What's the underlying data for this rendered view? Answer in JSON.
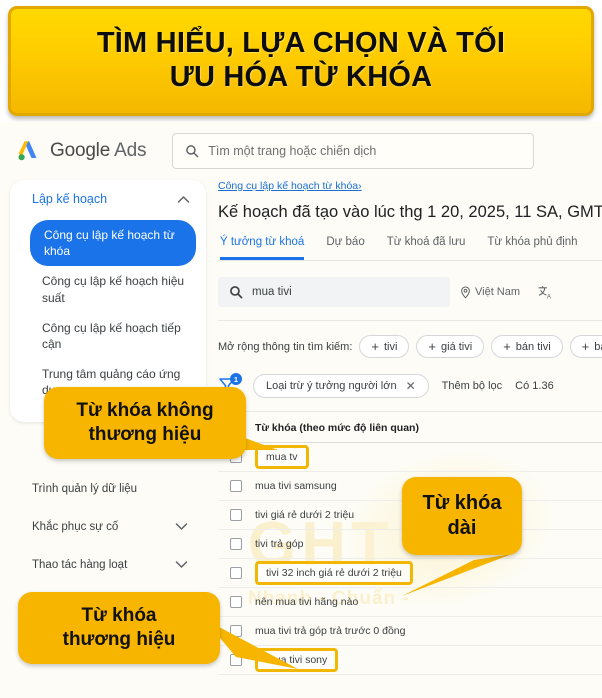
{
  "banner": {
    "line1": "TÌM HIỂU, LỰA CHỌN VÀ TỐI",
    "line2": "ƯU HÓA TỪ KHÓA"
  },
  "watermark": {
    "big": "GHT",
    "small": "Nhanh - Chuẩn -"
  },
  "topbar": {
    "logo_text": "Google",
    "logo_suffix": "Ads",
    "search_placeholder": "Tìm một trang hoặc chiến dịch",
    "search_icon": "search-icon"
  },
  "sidebar": {
    "header": "Lập kế hoạch",
    "header_chevron": "chevron-up-icon",
    "items": [
      {
        "label": "Công cụ lập kế hoạch từ khóa",
        "active": true
      },
      {
        "label": "Công cụ lập kế hoạch hiệu suất",
        "active": false
      },
      {
        "label": "Công cụ lập kế hoạch tiếp cận",
        "active": false
      },
      {
        "label": "Trung tâm quảng cáo ứng dụng",
        "active": false
      }
    ],
    "lower_items": [
      {
        "label": "Trình quản lý dữ liệu",
        "chevron": false
      },
      {
        "label": "Khắc phục sự cố",
        "chevron": true
      },
      {
        "label": "Thao tác hàng loạt",
        "chevron": true
      }
    ]
  },
  "main": {
    "breadcrumb": "Công cụ lập kế hoạch từ khóa",
    "breadcrumb_arrow": "›",
    "title": "Kế hoạch đã tạo vào lúc thg 1 20, 2025, 11 SA, GMT",
    "tabs": [
      {
        "label": "Ý tưởng từ khoá",
        "active": true
      },
      {
        "label": "Dự báo",
        "active": false
      },
      {
        "label": "Từ khoá đã lưu",
        "active": false
      },
      {
        "label": "Từ khóa phủ định",
        "active": false
      }
    ],
    "keyword_search": {
      "value": "mua tivi",
      "icon": "search-icon"
    },
    "location": {
      "label": "Việt Nam",
      "icon": "location-pin-icon"
    },
    "language_icon": "translate-icon",
    "expand": {
      "label": "Mở rộng thông tin tìm kiếm:",
      "chips": [
        "tivi",
        "giá tivi",
        "bán tivi",
        "ban t"
      ]
    },
    "filters": {
      "icon": "filter-icon",
      "badge": "1",
      "chip": "Loại trừ ý tưởng người lớn",
      "chip_close_icon": "close-icon",
      "add_filter": "Thêm bộ lọc",
      "count": "Có 1.36"
    },
    "table": {
      "header": "Từ khóa (theo mức độ liên quan)",
      "rows": [
        {
          "keyword": "mua tv",
          "highlight": true
        },
        {
          "keyword": "mua tivi samsung",
          "highlight": false
        },
        {
          "keyword": "tivi giá rẻ dưới 2 triệu",
          "highlight": false
        },
        {
          "keyword": "tivi trả góp",
          "highlight": false
        },
        {
          "keyword": "tivi 32 inch giá rẻ dưới 2 triệu",
          "highlight": true
        },
        {
          "keyword": "nên mua tivi hãng nào",
          "highlight": false
        },
        {
          "keyword": "mua tivi trả góp trả trước 0 đồng",
          "highlight": false
        },
        {
          "keyword": "mua tivi sony",
          "highlight": true
        }
      ]
    }
  },
  "callouts": [
    {
      "id": "no-brand",
      "line1": "Từ khóa không",
      "line2": "thương hiệu"
    },
    {
      "id": "long-tail",
      "line1": "Từ khóa",
      "line2": "dài"
    },
    {
      "id": "brand",
      "line1": "Từ khóa",
      "line2": "thương hiệu"
    }
  ],
  "colors": {
    "brand_yellow": "#f7b500",
    "banner_yellow": "#ffd000",
    "google_blue": "#1a73e8",
    "highlight_border": "#f2b705"
  }
}
